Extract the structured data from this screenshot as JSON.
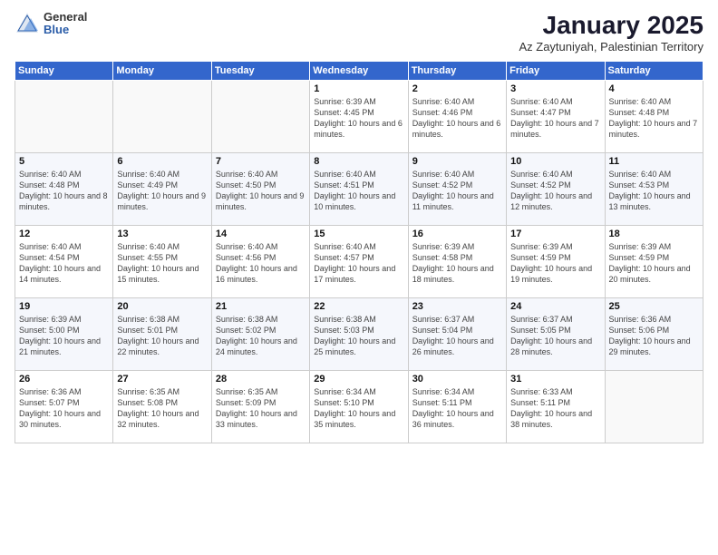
{
  "header": {
    "logo_general": "General",
    "logo_blue": "Blue",
    "title": "January 2025",
    "subtitle": "Az Zaytuniyah, Palestinian Territory"
  },
  "days_of_week": [
    "Sunday",
    "Monday",
    "Tuesday",
    "Wednesday",
    "Thursday",
    "Friday",
    "Saturday"
  ],
  "weeks": [
    [
      {
        "num": "",
        "info": ""
      },
      {
        "num": "",
        "info": ""
      },
      {
        "num": "",
        "info": ""
      },
      {
        "num": "1",
        "info": "Sunrise: 6:39 AM\nSunset: 4:45 PM\nDaylight: 10 hours and 6 minutes."
      },
      {
        "num": "2",
        "info": "Sunrise: 6:40 AM\nSunset: 4:46 PM\nDaylight: 10 hours and 6 minutes."
      },
      {
        "num": "3",
        "info": "Sunrise: 6:40 AM\nSunset: 4:47 PM\nDaylight: 10 hours and 7 minutes."
      },
      {
        "num": "4",
        "info": "Sunrise: 6:40 AM\nSunset: 4:48 PM\nDaylight: 10 hours and 7 minutes."
      }
    ],
    [
      {
        "num": "5",
        "info": "Sunrise: 6:40 AM\nSunset: 4:48 PM\nDaylight: 10 hours and 8 minutes."
      },
      {
        "num": "6",
        "info": "Sunrise: 6:40 AM\nSunset: 4:49 PM\nDaylight: 10 hours and 9 minutes."
      },
      {
        "num": "7",
        "info": "Sunrise: 6:40 AM\nSunset: 4:50 PM\nDaylight: 10 hours and 9 minutes."
      },
      {
        "num": "8",
        "info": "Sunrise: 6:40 AM\nSunset: 4:51 PM\nDaylight: 10 hours and 10 minutes."
      },
      {
        "num": "9",
        "info": "Sunrise: 6:40 AM\nSunset: 4:52 PM\nDaylight: 10 hours and 11 minutes."
      },
      {
        "num": "10",
        "info": "Sunrise: 6:40 AM\nSunset: 4:52 PM\nDaylight: 10 hours and 12 minutes."
      },
      {
        "num": "11",
        "info": "Sunrise: 6:40 AM\nSunset: 4:53 PM\nDaylight: 10 hours and 13 minutes."
      }
    ],
    [
      {
        "num": "12",
        "info": "Sunrise: 6:40 AM\nSunset: 4:54 PM\nDaylight: 10 hours and 14 minutes."
      },
      {
        "num": "13",
        "info": "Sunrise: 6:40 AM\nSunset: 4:55 PM\nDaylight: 10 hours and 15 minutes."
      },
      {
        "num": "14",
        "info": "Sunrise: 6:40 AM\nSunset: 4:56 PM\nDaylight: 10 hours and 16 minutes."
      },
      {
        "num": "15",
        "info": "Sunrise: 6:40 AM\nSunset: 4:57 PM\nDaylight: 10 hours and 17 minutes."
      },
      {
        "num": "16",
        "info": "Sunrise: 6:39 AM\nSunset: 4:58 PM\nDaylight: 10 hours and 18 minutes."
      },
      {
        "num": "17",
        "info": "Sunrise: 6:39 AM\nSunset: 4:59 PM\nDaylight: 10 hours and 19 minutes."
      },
      {
        "num": "18",
        "info": "Sunrise: 6:39 AM\nSunset: 4:59 PM\nDaylight: 10 hours and 20 minutes."
      }
    ],
    [
      {
        "num": "19",
        "info": "Sunrise: 6:39 AM\nSunset: 5:00 PM\nDaylight: 10 hours and 21 minutes."
      },
      {
        "num": "20",
        "info": "Sunrise: 6:38 AM\nSunset: 5:01 PM\nDaylight: 10 hours and 22 minutes."
      },
      {
        "num": "21",
        "info": "Sunrise: 6:38 AM\nSunset: 5:02 PM\nDaylight: 10 hours and 24 minutes."
      },
      {
        "num": "22",
        "info": "Sunrise: 6:38 AM\nSunset: 5:03 PM\nDaylight: 10 hours and 25 minutes."
      },
      {
        "num": "23",
        "info": "Sunrise: 6:37 AM\nSunset: 5:04 PM\nDaylight: 10 hours and 26 minutes."
      },
      {
        "num": "24",
        "info": "Sunrise: 6:37 AM\nSunset: 5:05 PM\nDaylight: 10 hours and 28 minutes."
      },
      {
        "num": "25",
        "info": "Sunrise: 6:36 AM\nSunset: 5:06 PM\nDaylight: 10 hours and 29 minutes."
      }
    ],
    [
      {
        "num": "26",
        "info": "Sunrise: 6:36 AM\nSunset: 5:07 PM\nDaylight: 10 hours and 30 minutes."
      },
      {
        "num": "27",
        "info": "Sunrise: 6:35 AM\nSunset: 5:08 PM\nDaylight: 10 hours and 32 minutes."
      },
      {
        "num": "28",
        "info": "Sunrise: 6:35 AM\nSunset: 5:09 PM\nDaylight: 10 hours and 33 minutes."
      },
      {
        "num": "29",
        "info": "Sunrise: 6:34 AM\nSunset: 5:10 PM\nDaylight: 10 hours and 35 minutes."
      },
      {
        "num": "30",
        "info": "Sunrise: 6:34 AM\nSunset: 5:11 PM\nDaylight: 10 hours and 36 minutes."
      },
      {
        "num": "31",
        "info": "Sunrise: 6:33 AM\nSunset: 5:11 PM\nDaylight: 10 hours and 38 minutes."
      },
      {
        "num": "",
        "info": ""
      }
    ]
  ]
}
